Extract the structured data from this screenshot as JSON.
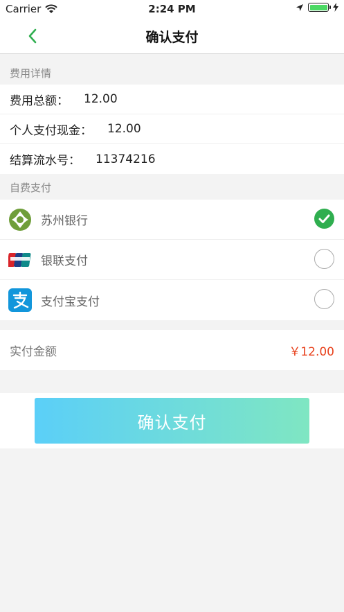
{
  "status_bar": {
    "carrier": "Carrier",
    "time": "2:24 PM"
  },
  "nav": {
    "title": "确认支付"
  },
  "fee_details": {
    "header": "费用详情",
    "rows": [
      {
        "label": "费用总额：",
        "value": "12.00"
      },
      {
        "label": "个人支付现金：",
        "value": "12.00"
      },
      {
        "label": "结算流水号：",
        "value": "11374216"
      }
    ]
  },
  "self_pay": {
    "header": "自费支付",
    "methods": [
      {
        "label": "苏州银行",
        "icon": "suzhou-bank-icon",
        "selected": true
      },
      {
        "label": "银联支付",
        "icon": "unionpay-icon",
        "selected": false
      },
      {
        "label": "支付宝支付",
        "icon": "alipay-icon",
        "selected": false
      }
    ]
  },
  "amount": {
    "label": "实付金额",
    "value": "￥12.00"
  },
  "confirm_button": {
    "label": "确认支付"
  },
  "colors": {
    "accent_green": "#2fae4f",
    "price_red": "#e8421d",
    "button_gradient_start": "#5bcff8",
    "button_gradient_end": "#7fe6c2"
  }
}
